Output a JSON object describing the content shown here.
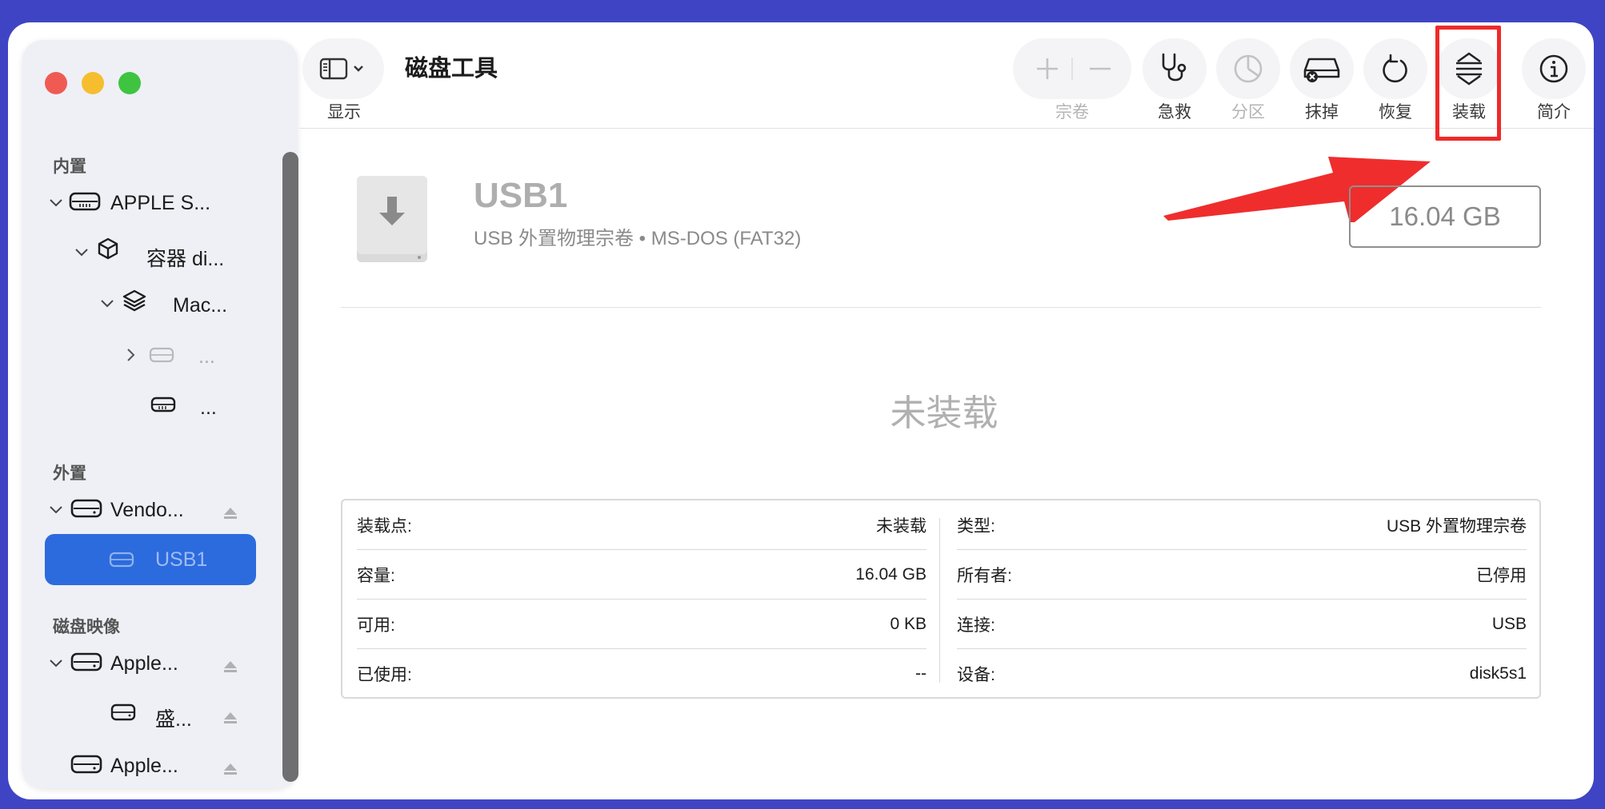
{
  "app": {
    "title": "磁盘工具"
  },
  "toolbar": {
    "view_label": "显示",
    "volume_label": "宗卷",
    "firstaid_label": "急救",
    "partition_label": "分区",
    "erase_label": "抹掉",
    "restore_label": "恢复",
    "mount_label": "装载",
    "info_label": "简介"
  },
  "sidebar": {
    "internal_label": "内置",
    "external_label": "外置",
    "images_label": "磁盘映像",
    "items": [
      {
        "label": "APPLE S..."
      },
      {
        "label": "容器 di..."
      },
      {
        "label": "Mac..."
      },
      {
        "label": "..."
      },
      {
        "label": "..."
      },
      {
        "label": "Vendo..."
      },
      {
        "label": "USB1"
      },
      {
        "label": "Apple..."
      },
      {
        "label": "盛..."
      },
      {
        "label": "Apple..."
      }
    ]
  },
  "volume": {
    "name": "USB1",
    "subtitle": "USB 外置物理宗卷 • MS-DOS (FAT32)",
    "capacity": "16.04 GB",
    "status": "未装载"
  },
  "info": {
    "left": [
      {
        "k": "装载点:",
        "v": "未装载"
      },
      {
        "k": "容量:",
        "v": "16.04 GB"
      },
      {
        "k": "可用:",
        "v": "0 KB"
      },
      {
        "k": "已使用:",
        "v": "--"
      }
    ],
    "right": [
      {
        "k": "类型:",
        "v": "USB 外置物理宗卷"
      },
      {
        "k": "所有者:",
        "v": "已停用"
      },
      {
        "k": "连接:",
        "v": "USB"
      },
      {
        "k": "设备:",
        "v": "disk5s1"
      }
    ]
  },
  "colors": {
    "accent": "#2c6bde",
    "annotation": "#ee2a2a",
    "background": "#3f44c4"
  }
}
